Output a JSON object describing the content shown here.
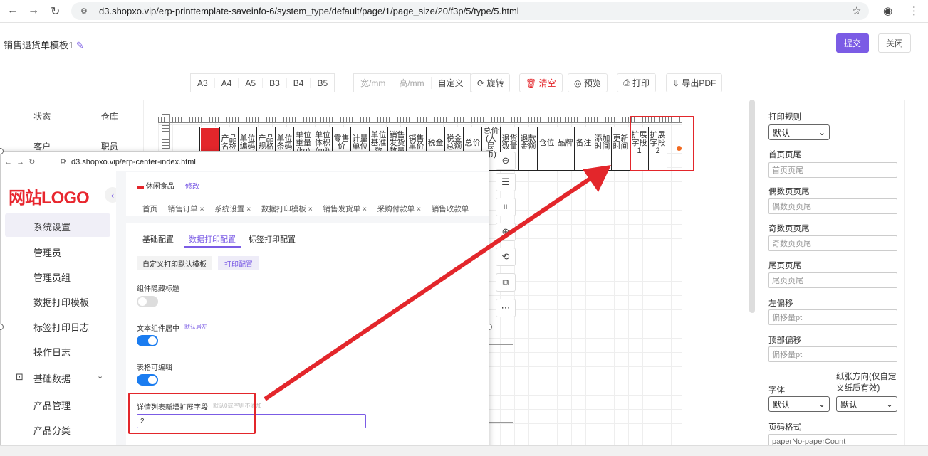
{
  "browser": {
    "url": "d3.shopxo.vip/erp-printtemplate-saveinfo-6/system_type/default/page/1/page_size/20/f3p/5/type/5.html"
  },
  "editor": {
    "title": "销售退货单模板1",
    "submit": "提交",
    "close": "关闭",
    "sizes": [
      "A3",
      "A4",
      "A5",
      "B3",
      "B4",
      "B5"
    ],
    "width_placeholder": "宽/mm",
    "height_placeholder": "高/mm",
    "custom": "自定义",
    "rotate": "旋转",
    "clear": "清空",
    "preview": "预览",
    "print": "打印",
    "export_pdf": "导出PDF"
  },
  "components": {
    "row1": [
      "状态",
      "仓库"
    ],
    "row2": [
      "客户",
      "职员"
    ]
  },
  "print_table": {
    "headers": [
      "",
      "产品名称",
      "单位编码",
      "产品规格",
      "单位条码",
      "单位重量(kg)",
      "单位体积(m³)",
      "零售价",
      "计量单位",
      "单位基准数",
      "销售发货数量",
      "销售单价",
      "税金",
      "税金总额",
      "总价",
      "总价(人民币)",
      "退货数量",
      "退款金额",
      "仓位",
      "品牌",
      "备注",
      "添加时间",
      "更新时间",
      "扩展字段1",
      "扩展字段2"
    ]
  },
  "settings": {
    "print_rule_label": "打印规则",
    "print_rule_value": "默认",
    "first_page_label": "首页页尾",
    "first_page_ph": "首页页尾",
    "even_page_label": "偶数页页尾",
    "even_page_ph": "偶数页页尾",
    "odd_page_label": "奇数页页尾",
    "odd_page_ph": "奇数页页尾",
    "last_page_label": "尾页页尾",
    "last_page_ph": "尾页页尾",
    "left_offset_label": "左偏移",
    "left_offset_ph": "偏移量pt",
    "top_offset_label": "顶部偏移",
    "top_offset_ph": "偏移量pt",
    "font_label": "字体",
    "font_value": "默认",
    "orientation_label": "纸张方向(仅自定义纸质有效)",
    "orientation_value": "默认",
    "page_format_label": "页码格式",
    "page_format_value": "paperNo-paperCount"
  },
  "overlay": {
    "url": "d3.shopxo.vip/erp-center-index.html",
    "logo": "网站LOGO",
    "store": "休闲食品",
    "edit": "修改",
    "menu": [
      "系统设置",
      "管理员",
      "管理员组",
      "数据打印模板",
      "标签打印日志",
      "操作日志",
      "基础数据",
      "产品管理",
      "产品分类"
    ],
    "tabs": "首页     销售订单 ×     系统设置 ×     数据打印模板 ×     销售发货单 ×     采购付款单 ×     销售收款单",
    "subtabs": [
      "基础配置",
      "数据打印配置",
      "标签打印配置"
    ],
    "buttons": [
      "自定义打印默认模板",
      "打印配置"
    ],
    "hide_title_label": "组件隐藏标题",
    "text_center_label": "文本组件居中",
    "text_center_hint": "默认居左",
    "table_edit_label": "表格可编辑",
    "ext_field_label": "详情列表新增扩展字段",
    "ext_field_hint": "默认0或空则不添加",
    "ext_field_value": "2"
  }
}
